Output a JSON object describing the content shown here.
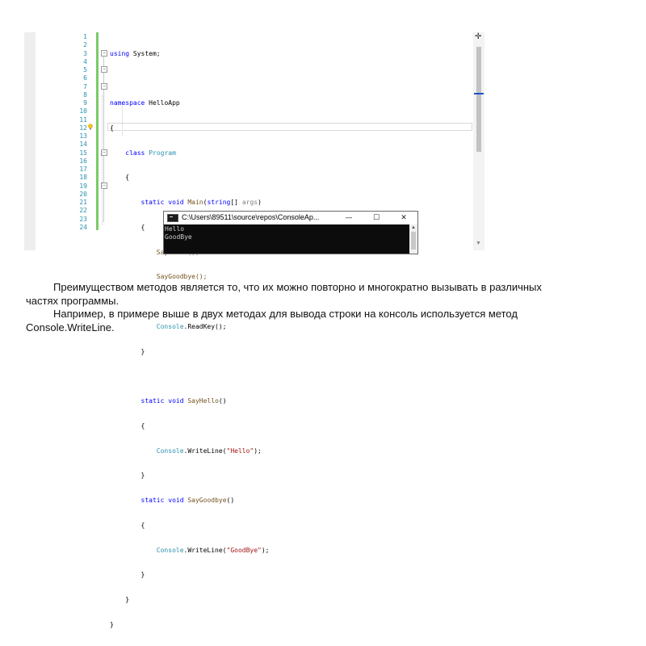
{
  "editor": {
    "line_numbers": [
      "1",
      "2",
      "3",
      "4",
      "5",
      "6",
      "7",
      "8",
      "9",
      "10",
      "11",
      "12",
      "13",
      "14",
      "15",
      "16",
      "17",
      "18",
      "19",
      "20",
      "21",
      "22",
      "23",
      "24"
    ],
    "split_icon": "split-window-icon"
  },
  "code": {
    "l1_kw": "using",
    "l1_rest": " System;",
    "l3_kw": "namespace",
    "l3_rest": " HelloApp",
    "open_brace": "{",
    "close_brace": "}",
    "l5_kw": "class",
    "l5_type": "Program",
    "l7_kw1": "static",
    "l7_kw2": "void",
    "l7_name": "Main",
    "l7_p1": "(",
    "l7_kw3": "string",
    "l7_p2": "[] ",
    "l7_arg": "args",
    "l7_p3": ")",
    "l9": "SayHello();",
    "l10": "SayGoodbye();",
    "l12_type": "Console",
    "l12_rest": ".ReadKey();",
    "l15_name": "SayHello",
    "l15_rest": "()",
    "l17_type": "Console",
    "l17_m": ".WriteLine(",
    "l17_str": "\"Hello\"",
    "l17_end": ");",
    "l19_name": "SayGoodbye",
    "l19_rest": "()",
    "l21_type": "Console",
    "l21_m": ".WriteLine(",
    "l21_str": "\"GoodBye\"",
    "l21_end": ");"
  },
  "console_window": {
    "title": "C:\\Users\\89511\\source\\repos\\ConsoleAp...",
    "minimize": "—",
    "maximize": "☐",
    "close": "✕",
    "output": [
      "Hello",
      "GoodBye"
    ]
  },
  "text": {
    "p1": "Преимуществом методов является то, что их можно повторно и многократно вызывать в различных частях программы.",
    "p2_a": "Например, в примере выше в двух методах для вывода строки на консоль используется метод ",
    "p2_b": "Console.WriteLine",
    "p2_c": "."
  },
  "colors": {
    "keyword": "#0000ff",
    "type": "#2b91af",
    "string": "#a31515",
    "change_bar": "#7cc96a",
    "console_bg": "#0c0c0c"
  }
}
